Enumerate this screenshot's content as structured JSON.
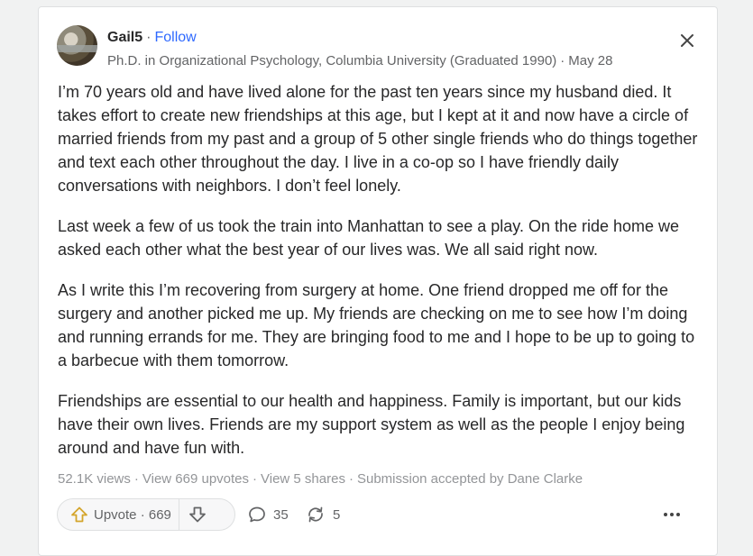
{
  "author": {
    "name": "Gail5",
    "follow_label": "Follow",
    "credential": "Ph.D. in Organizational Psychology, Columbia University (Graduated 1990)",
    "date": "May 28"
  },
  "separator": "·",
  "paragraphs": [
    "I’m 70 years old and have lived alone for the past ten years since my husband died. It takes effort to create new friendships at this age, but I kept at it and now have a circle of married friends from my past and a group of 5 other single friends who do things together and text each other throughout the day. I live in a co-op so I have friendly daily conversations with neighbors. I don’t feel lonely.",
    "Last week a few of us took the train into Manhattan to see a play. On the ride home we asked each other what the best year of our lives was. We all said right now.",
    "As I write this I’m recovering from surgery at home. One friend dropped me off for the surgery and another picked me up. My friends are checking on me to see how I’m doing and running errands for me. They are bringing food to me and I hope to be up to going to a barbecue with them tomorrow.",
    "Friendships are essential to our health and happiness. Family is important, but our kids have their own lives. Friends are my support system as well as the people I enjoy being around and have fun with."
  ],
  "stats": {
    "views": "52.1K views",
    "upvotes_link": "View 669 upvotes",
    "shares_link": "View 5 shares",
    "submission": "Submission accepted by Dane Clarke"
  },
  "actions": {
    "upvote_label": "Upvote",
    "upvote_count": "669",
    "comments_count": "35",
    "shares_count": "5"
  },
  "icons": {
    "close": "close-icon",
    "upvote": "upvote-arrow-icon",
    "downvote": "downvote-arrow-icon",
    "comment": "comment-bubble-icon",
    "share": "reshare-icon",
    "more": "more-dots-icon"
  },
  "colors": {
    "link": "#2e69ff",
    "text": "#282829",
    "muted": "#636466",
    "upvote_icon": "#d4a52c"
  }
}
